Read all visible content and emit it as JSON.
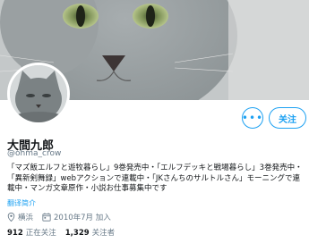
{
  "profile": {
    "display_name": "大間九郎",
    "handle": "@ohma_crow",
    "bio": "「マズ飯エルフと遊牧暮らし」9巻発売中・「エルフデッキと戦場暮らし」3巻発売中・「異新剣舞録」webアクションで連載中・「JKさんちのサルトルさん」モーニングで連載中・マンガ文章原作・小説お仕事募集中です",
    "translate_label": "翻译简介",
    "location": "横浜",
    "joined": "2010年7月 加入",
    "following_count": "912",
    "following_label": "正在关注",
    "followers_count": "1,329",
    "followers_label": "关注者"
  },
  "actions": {
    "more_label": "•••",
    "follow_label": "关注"
  },
  "icons": {
    "location": "location-pin-icon",
    "calendar": "calendar-icon",
    "more": "more-options-icon"
  },
  "colors": {
    "accent": "#1da1f2",
    "secondary_text": "#657786"
  }
}
